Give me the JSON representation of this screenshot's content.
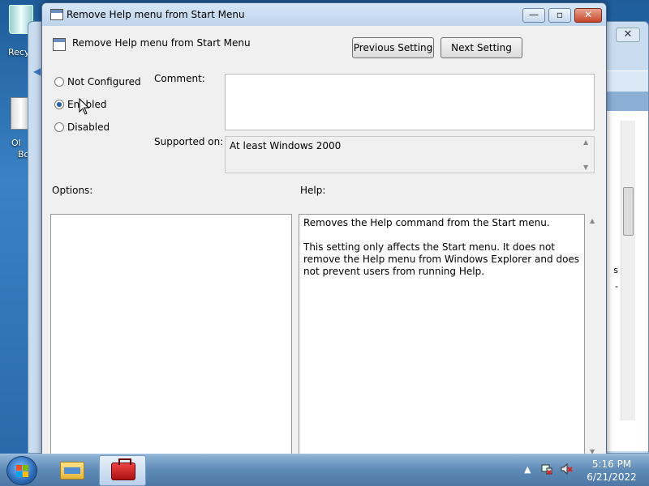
{
  "desktop": {
    "icons": [
      {
        "label": "Recy"
      },
      {
        "label_line1": "Ol",
        "label_line2": "Bo"
      }
    ]
  },
  "background_window": {
    "close_label": "✕",
    "side_text_1": "s",
    "side_text_2": "-"
  },
  "dialog": {
    "title": "Remove Help menu from Start Menu",
    "window_buttons": {
      "minimize": "—",
      "maximize": "▫",
      "close": "✕"
    },
    "policy_name": "Remove Help menu from Start Menu",
    "buttons": {
      "previous": "Previous Setting",
      "next": "Next Setting"
    },
    "radios": [
      {
        "label": "Not Configured",
        "checked": false
      },
      {
        "label": "Enabled",
        "checked": true
      },
      {
        "label": "Disabled",
        "checked": false
      }
    ],
    "comment_label": "Comment:",
    "comment_value": "",
    "supported_label": "Supported on:",
    "supported_value": "At least Windows 2000",
    "options_label": "Options:",
    "help_label": "Help:",
    "help_paragraphs": [
      "Removes the Help command from the Start menu.",
      "This setting only affects the Start menu. It does not remove the Help menu from Windows Explorer and does not prevent users from running Help."
    ]
  },
  "taskbar": {
    "items": [
      "start-button",
      "windows-explorer",
      "group-policy-editor"
    ],
    "tray": {
      "arrow": "▲"
    },
    "clock_time": "5:16 PM",
    "clock_date": "6/21/2022"
  },
  "colors": {
    "accent": "#1f5fa8",
    "close_button": "#c7452a",
    "desktop": "#2a6aab"
  }
}
